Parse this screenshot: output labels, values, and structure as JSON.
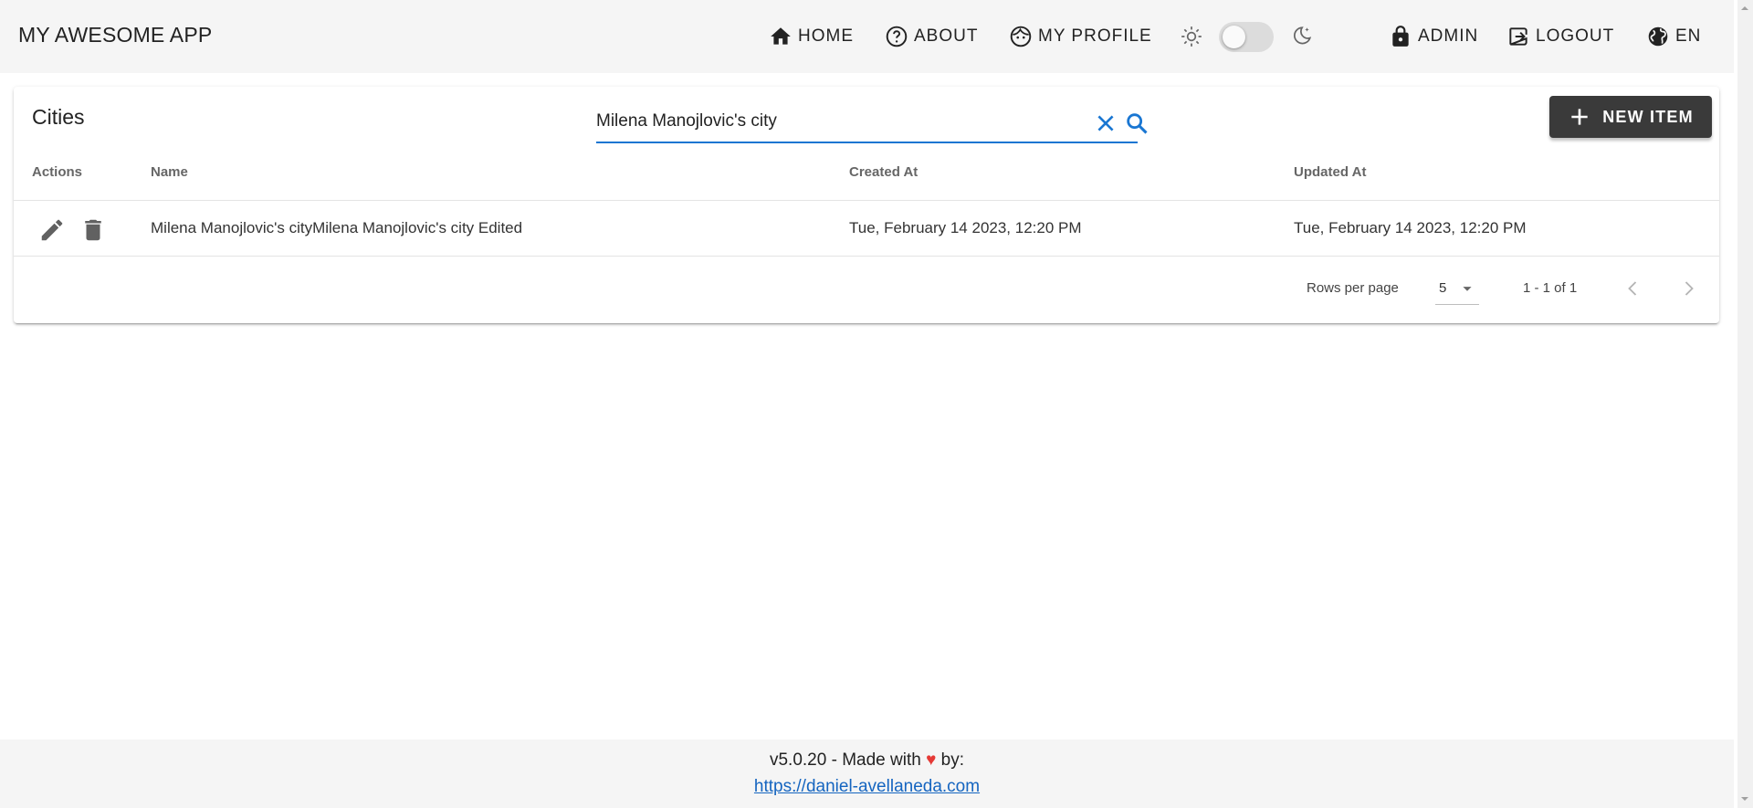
{
  "header": {
    "app_title": "MY AWESOME APP",
    "nav": {
      "home": "HOME",
      "about": "ABOUT",
      "profile": "MY PROFILE",
      "admin": "ADMIN",
      "logout": "LOGOUT",
      "language": "EN"
    },
    "theme_toggle_on": false
  },
  "page": {
    "title": "Cities",
    "search": {
      "value": "Milena Manojlovic's city",
      "placeholder": ""
    },
    "new_item_label": "NEW ITEM",
    "table": {
      "columns": [
        "Actions",
        "Name",
        "Created At",
        "Updated At"
      ],
      "rows": [
        {
          "name": "Milena Manojlovic's cityMilena Manojlovic's city Edited",
          "created_at": "Tue, February 14 2023, 12:20 PM",
          "updated_at": "Tue, February 14 2023, 12:20 PM"
        }
      ]
    },
    "pagination": {
      "rows_per_page_label": "Rows per page",
      "rows_per_page": "5",
      "range": "1 - 1 of 1"
    }
  },
  "footer": {
    "version_text": "v5.0.20 - Made with",
    "heart": "♥",
    "by_text": "by:",
    "link": "https://daniel-avellaneda.com"
  },
  "colors": {
    "accent": "#1976d2",
    "button_dark": "#3a3a3a",
    "heart": "#e53935"
  }
}
